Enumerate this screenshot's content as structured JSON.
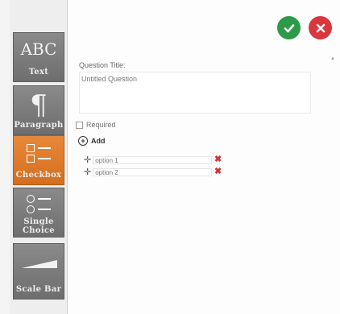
{
  "toolbar": {
    "tools": [
      {
        "icon": "abc-text-icon",
        "icon_text": "ABC",
        "label": "Text",
        "active": false
      },
      {
        "icon": "pilcrow-icon",
        "icon_text": "¶",
        "label": "Paragraph",
        "active": false
      },
      {
        "icon": "checkbox-list-icon",
        "label": "Checkbox",
        "active": true
      },
      {
        "icon": "radio-list-icon",
        "label": "Single Choice",
        "active": false
      },
      {
        "icon": "scale-icon",
        "label": "Scale Bar",
        "active": false
      }
    ],
    "accent_color": "#d9772a"
  },
  "actions": {
    "confirm_icon": "checkmark-icon",
    "cancel_icon": "close-icon",
    "confirm_color": "#2c9a48",
    "cancel_color": "#d9363e"
  },
  "form": {
    "question_title_label": "Question Title:",
    "question_title_value": "Untitled Question",
    "required_label": "Required",
    "required_checked": false,
    "add_label": "Add",
    "options": [
      {
        "value": "option 1"
      },
      {
        "value": "option 2"
      }
    ]
  }
}
